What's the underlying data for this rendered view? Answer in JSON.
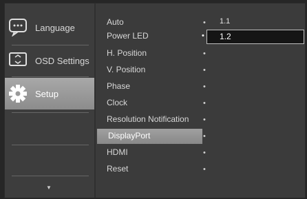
{
  "sidebar": {
    "items": [
      {
        "label": "Language",
        "icon": "language-icon"
      },
      {
        "label": "OSD Settings",
        "icon": "osd-settings-icon"
      },
      {
        "label": "Setup",
        "icon": "setup-gear-icon"
      }
    ],
    "scroll_indicator": "▼"
  },
  "menu": {
    "items": [
      {
        "label": "Auto",
        "value": "1.1"
      },
      {
        "label": "Power LED"
      },
      {
        "label": "H. Position"
      },
      {
        "label": "V. Position"
      },
      {
        "label": "Phase"
      },
      {
        "label": "Clock"
      },
      {
        "label": "Resolution Notification"
      },
      {
        "label": "DisplayPort"
      },
      {
        "label": "HDMI"
      },
      {
        "label": "Reset"
      }
    ],
    "dot": "•",
    "highlighted_value": "1.2"
  },
  "colors": {
    "background": "#3c3c3c",
    "highlight": "#9a9a9a",
    "text": "#d8d8d8"
  }
}
